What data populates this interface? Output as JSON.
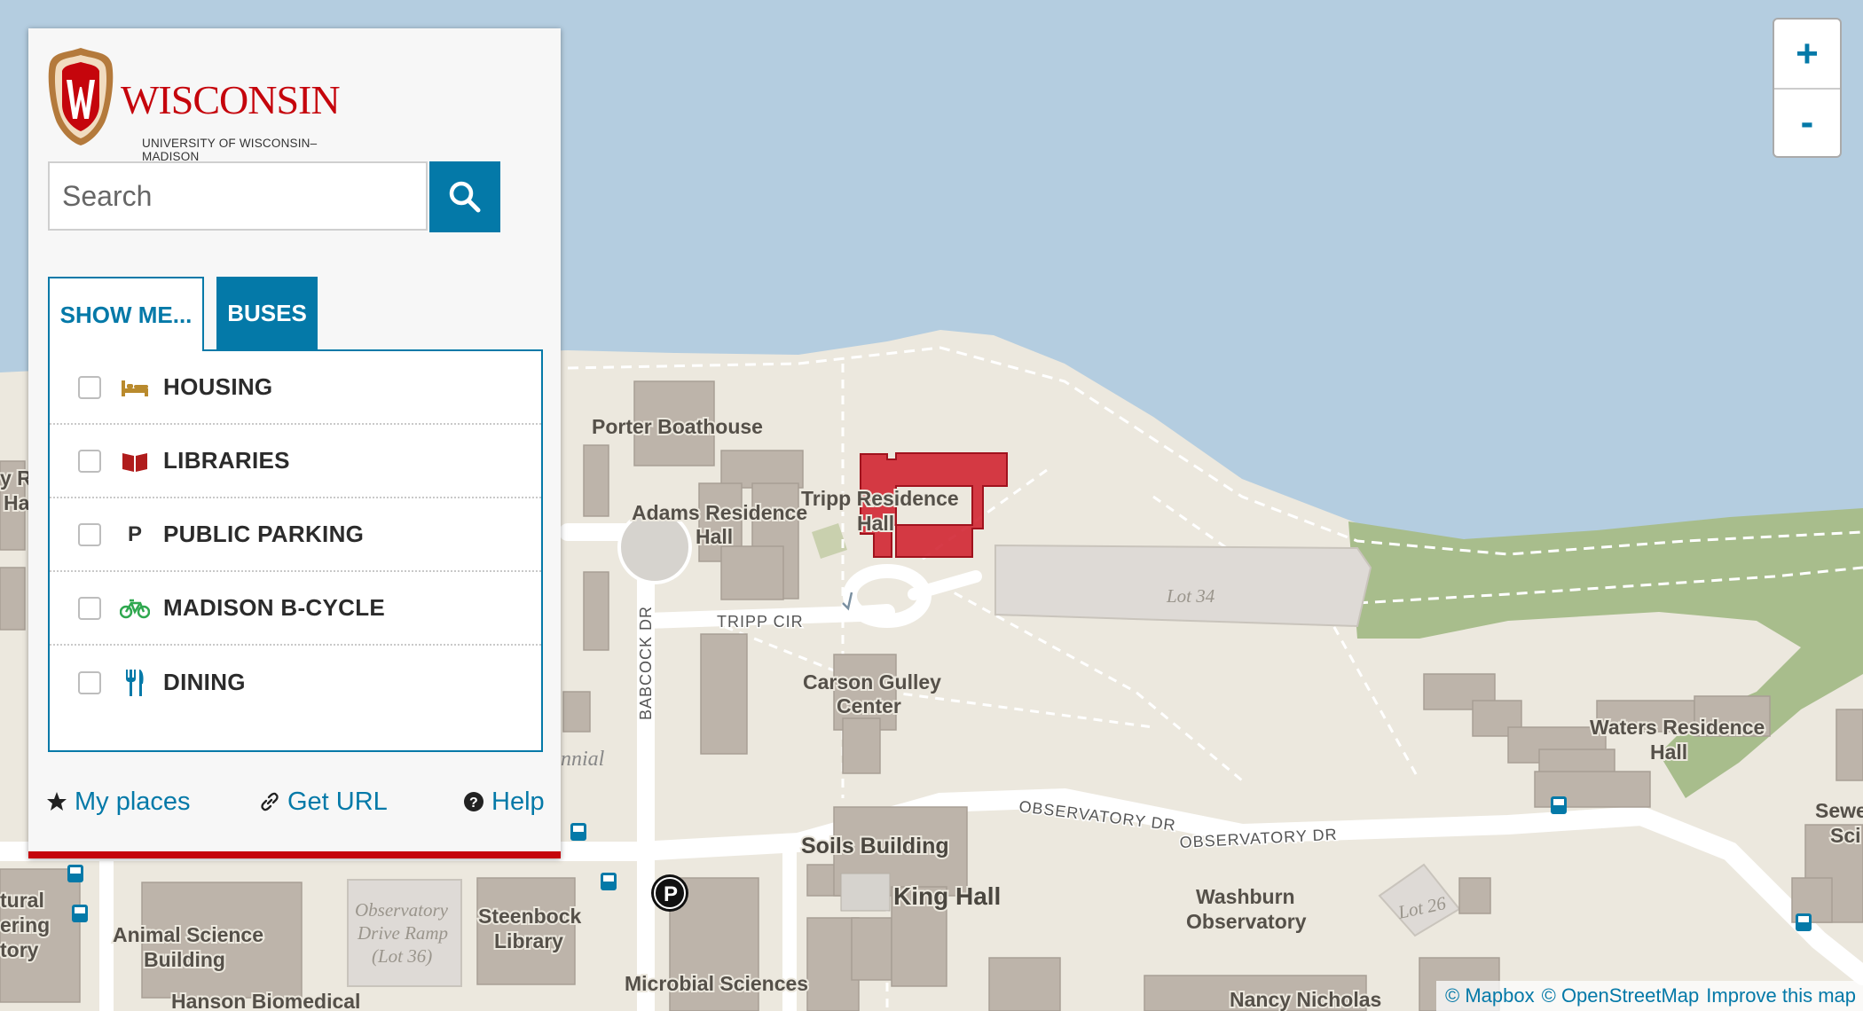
{
  "brand": {
    "word": "WISCONSIN",
    "subtitle": "UNIVERSITY OF WISCONSIN–MADISON",
    "color": "#c5050c"
  },
  "search": {
    "placeholder": "Search",
    "icon": "search-icon"
  },
  "tabs": {
    "show_me": "SHOW ME...",
    "buses": "BUSES"
  },
  "categories": [
    {
      "label": "HOUSING",
      "icon": "bed-icon",
      "color": "#b98a2d",
      "checked": false
    },
    {
      "label": "LIBRARIES",
      "icon": "book-icon",
      "color": "#b01c1c",
      "checked": false
    },
    {
      "label": "PUBLIC PARKING",
      "icon": "parking-icon",
      "glyph": "P",
      "color": "#333333",
      "checked": false
    },
    {
      "label": "MADISON B-CYCLE",
      "icon": "bicycle-icon",
      "color": "#2fa84f",
      "checked": false
    },
    {
      "label": "DINING",
      "icon": "utensils-icon",
      "color": "#0479a8",
      "checked": false
    }
  ],
  "footer": {
    "my_places": "My places",
    "get_url": "Get URL",
    "help": "Help"
  },
  "zoom": {
    "in": "+",
    "out": "-"
  },
  "attribution": {
    "mapbox": "© Mapbox",
    "osm": "© OpenStreetMap",
    "improve": "Improve this map"
  },
  "map": {
    "colors": {
      "water": "#b4cde0",
      "land": "#ece8de",
      "building": "#bdb4aa",
      "park": "#a8bd8c",
      "highlight": "#d0202e",
      "lot": "#dedad6",
      "road": "#ffffff",
      "accent": "#0479a8"
    },
    "buildings": {
      "porter": "Porter Boathouse",
      "adams_1": "Adams Residence",
      "adams_2": "Hall",
      "tripp_1": "Tripp Residence",
      "tripp_2": "Hall",
      "carson_1": "Carson Gulley",
      "carson_2": "Center",
      "waters_1": "Waters Residence",
      "waters_2": "Hall",
      "soils": "Soils Building",
      "king": "King Hall",
      "washburn_1": "Washburn",
      "washburn_2": "Observatory",
      "steenbock_1": "Steenbock",
      "steenbock_2": "Library",
      "animal_1": "Animal Science",
      "animal_2": "Building",
      "hanson": "Hanson Biomedical",
      "microbial": "Microbial Sciences",
      "nancy": "Nancy Nicholas",
      "sewell_1": "Sewe",
      "sewell_2": "Sci",
      "edge_1": "y R",
      "edge_2": "Ha",
      "edge_3": "tural",
      "edge_4": "ering",
      "edge_5": "tory",
      "centennial": "nnial"
    },
    "roads": {
      "tripp_cir": "TRIPP CIR",
      "babcock": "BABCOCK DR",
      "observatory_1": "OBSERVATORY DR",
      "observatory_2": "OBSERVATORY DR"
    },
    "lots": {
      "lot34": "Lot 34",
      "lot26": "Lot 26",
      "ramp_1": "Observatory",
      "ramp_2": "Drive Ramp",
      "ramp_3": "(Lot 36)"
    },
    "parking_marker": "P"
  }
}
